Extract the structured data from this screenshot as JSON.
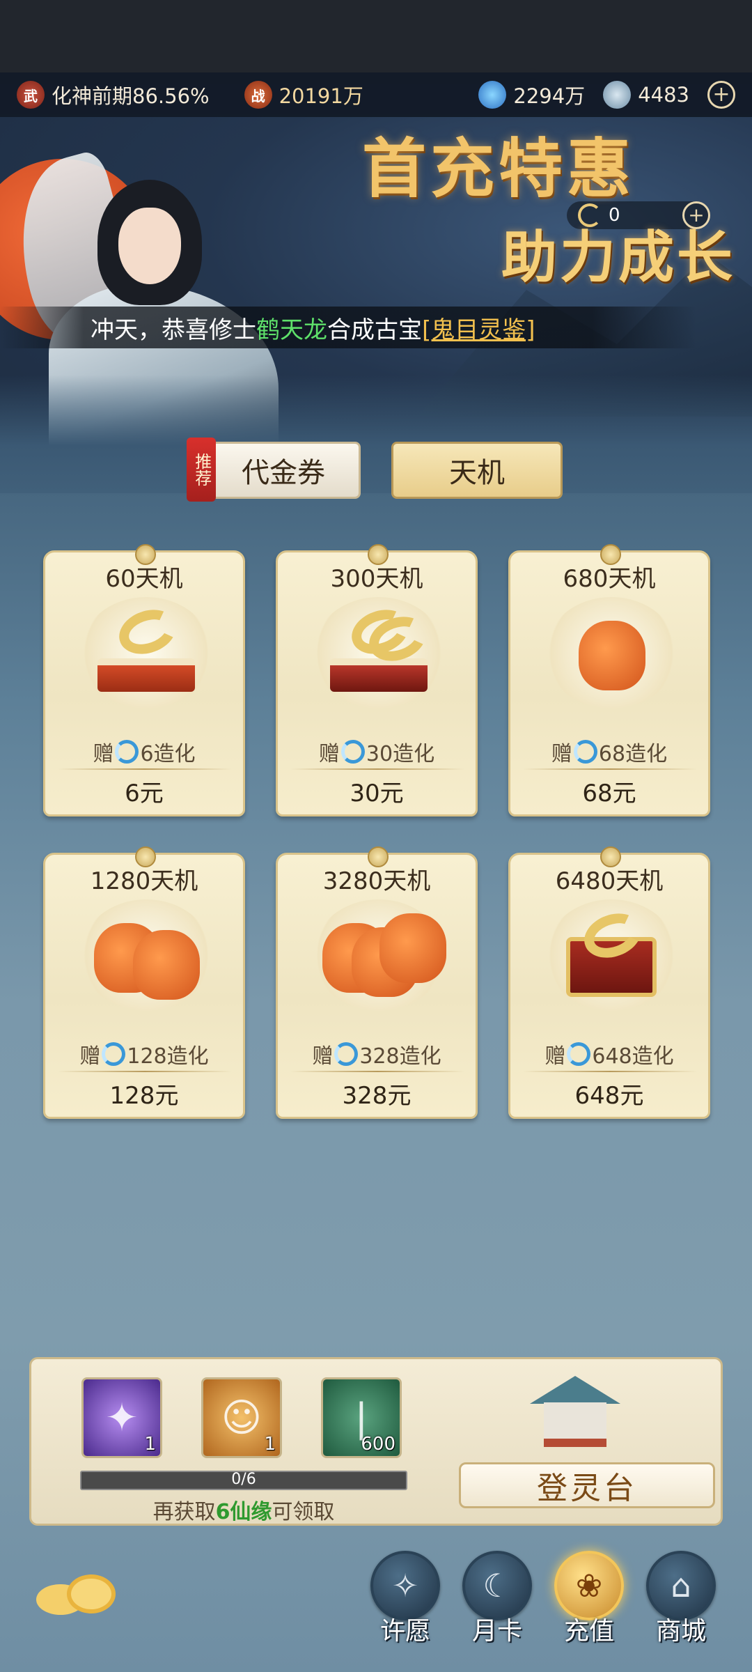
{
  "topbar": {
    "realm_icon": "wu-icon",
    "realm_icon_text": "武",
    "realm_text": "化神前期86.56%",
    "power_icon": "zhan-icon",
    "power_icon_text": "战",
    "power_value": "20191万",
    "crystal_value": "2294万",
    "coil_value": "4483",
    "add_symbol": "+"
  },
  "banner": {
    "event_currency_value": "0",
    "add_symbol": "+",
    "promo_title": "首充特惠",
    "promo_subtitle": "助力成长",
    "ticker": {
      "prefix": "冲天，恭喜修士",
      "player_name": "鹤天龙",
      "middle": "合成古宝",
      "item_name": "[鬼目灵鉴]"
    }
  },
  "tabs": {
    "recommend_badge": "推荐",
    "voucher_label": "代金券",
    "tianji_label": "天机"
  },
  "packages": [
    {
      "name": "60天机",
      "bonus_prefix": "赠",
      "bonus_suffix": "6造化",
      "price": "6元",
      "art": "gold-seal"
    },
    {
      "name": "300天机",
      "bonus_prefix": "赠",
      "bonus_suffix": "30造化",
      "price": "30元",
      "art": "gold-seal-stack"
    },
    {
      "name": "680天机",
      "bonus_prefix": "赠",
      "bonus_suffix": "68造化",
      "price": "68元",
      "art": "treasure-bag"
    },
    {
      "name": "1280天机",
      "bonus_prefix": "赠",
      "bonus_suffix": "128造化",
      "price": "128元",
      "art": "treasure-bags"
    },
    {
      "name": "3280天机",
      "bonus_prefix": "赠",
      "bonus_suffix": "328造化",
      "price": "328元",
      "art": "treasure-bags"
    },
    {
      "name": "6480天机",
      "bonus_prefix": "赠",
      "bonus_suffix": "648造化",
      "price": "648元",
      "art": "treasure-chest"
    }
  ],
  "reward_panel": {
    "items": [
      {
        "icon": "jade-flute-icon",
        "qty": "1"
      },
      {
        "icon": "character-portrait-icon",
        "qty": "1"
      },
      {
        "icon": "scroll-bundle-icon",
        "qty": "600"
      }
    ],
    "progress_text": "0/6",
    "progress_fraction": 0,
    "hint_prefix": "再获取",
    "hint_highlight": "6仙缘",
    "hint_suffix": "可领取",
    "platform_button": "登灵台"
  },
  "nav": [
    {
      "label": "许愿",
      "icon": "wish-icon",
      "active": false
    },
    {
      "label": "月卡",
      "icon": "month-card-icon",
      "active": false
    },
    {
      "label": "充值",
      "icon": "recharge-icon",
      "active": true
    },
    {
      "label": "商城",
      "icon": "shop-icon",
      "active": false
    }
  ],
  "colors": {
    "accent_gold": "#f2c46a",
    "highlight_green": "#5ee06a",
    "card_bg": "#f8f0d2"
  }
}
